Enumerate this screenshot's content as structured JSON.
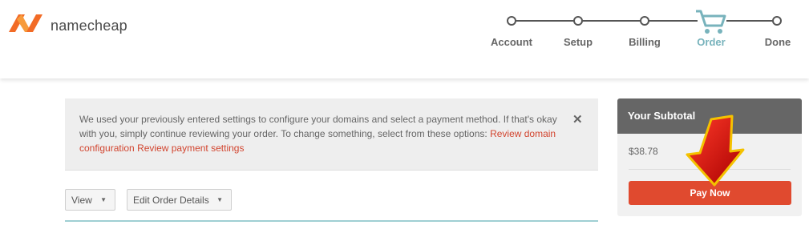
{
  "brand": {
    "name": "namecheap",
    "accent": "#f26b26"
  },
  "progress": {
    "steps": [
      {
        "label": "Account",
        "state": "done"
      },
      {
        "label": "Setup",
        "state": "done"
      },
      {
        "label": "Billing",
        "state": "done"
      },
      {
        "label": "Order",
        "state": "current",
        "icon": "cart-icon"
      },
      {
        "label": "Done",
        "state": "upcoming"
      }
    ],
    "active_color": "#78b3bc"
  },
  "notice": {
    "text": "We used your previously entered settings to configure your domains and select a payment method. If that's okay with you, simply continue reviewing your order. To change something, select from these options:",
    "link_review_domain": "Review domain configuration",
    "link_review_payment": "Review payment settings",
    "close_glyph": "✕"
  },
  "toolbar": {
    "view_label": "View",
    "edit_order_label": "Edit Order Details"
  },
  "summary": {
    "title": "Your Subtotal",
    "amount": "$38.78",
    "pay_button": "Pay Now",
    "button_color": "#e04a2f"
  }
}
